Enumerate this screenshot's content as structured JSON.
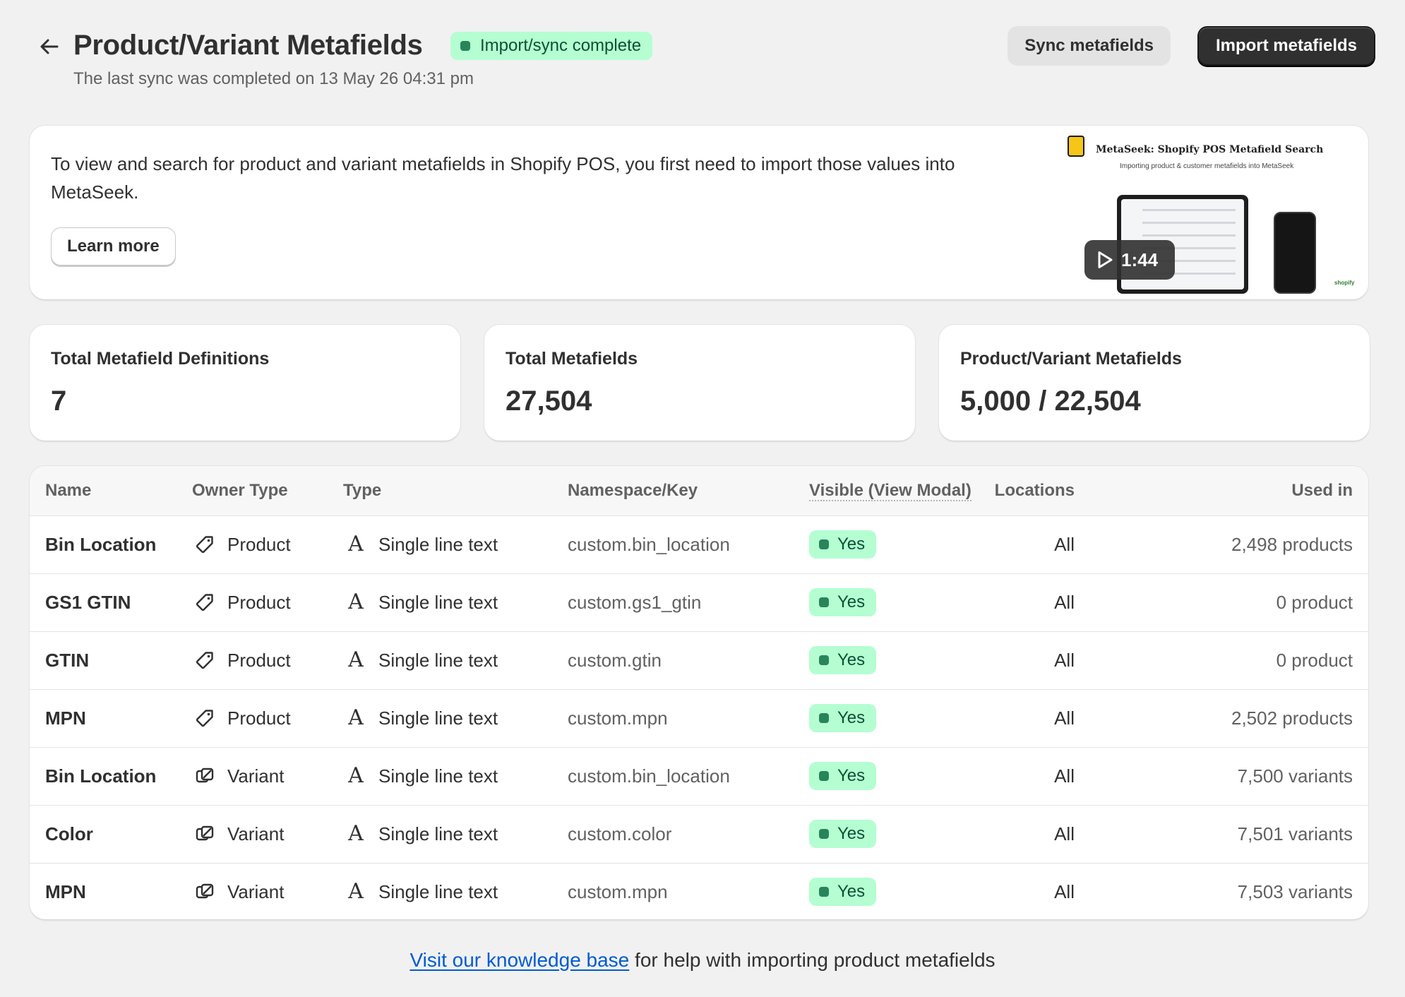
{
  "header": {
    "title": "Product/Variant Metafields",
    "status_badge": "Import/sync complete",
    "subtitle": "The last sync was completed on 13 May 26 04:31 pm",
    "sync_button": "Sync metafields",
    "import_button": "Import metafields",
    "back_icon": "arrow-left-icon"
  },
  "banner": {
    "text": "To view and search for product and variant metafields in Shopify POS, you first need to import those values into MetaSeek.",
    "learn_more": "Learn more",
    "video": {
      "title": "MetaSeek: Shopify POS Metafield Search",
      "subtitle": "Importing product & customer metafields into MetaSeek",
      "duration": "1:44",
      "brand": "shopify"
    }
  },
  "stats": [
    {
      "label": "Total Metafield Definitions",
      "value": "7"
    },
    {
      "label": "Total Metafields",
      "value": "27,504"
    },
    {
      "label": "Product/Variant Metafields",
      "value": "5,000 / 22,504"
    }
  ],
  "table": {
    "columns": [
      "Name",
      "Owner Type",
      "Type",
      "Namespace/Key",
      "Visible (View Modal)",
      "Locations",
      "Used in"
    ],
    "rows": [
      {
        "name": "Bin Location",
        "owner": "Product",
        "owner_icon": "tag-icon",
        "type": "Single line text",
        "type_icon": "text-icon",
        "key": "custom.bin_location",
        "visible": "Yes",
        "locations": "All",
        "used_in": "2,498 products"
      },
      {
        "name": "GS1 GTIN",
        "owner": "Product",
        "owner_icon": "tag-icon",
        "type": "Single line text",
        "type_icon": "text-icon",
        "key": "custom.gs1_gtin",
        "visible": "Yes",
        "locations": "All",
        "used_in": "0 product"
      },
      {
        "name": "GTIN",
        "owner": "Product",
        "owner_icon": "tag-icon",
        "type": "Single line text",
        "type_icon": "text-icon",
        "key": "custom.gtin",
        "visible": "Yes",
        "locations": "All",
        "used_in": "0 product"
      },
      {
        "name": "MPN",
        "owner": "Product",
        "owner_icon": "tag-icon",
        "type": "Single line text",
        "type_icon": "text-icon",
        "key": "custom.mpn",
        "visible": "Yes",
        "locations": "All",
        "used_in": "2,502 products"
      },
      {
        "name": "Bin Location",
        "owner": "Variant",
        "owner_icon": "variant-icon",
        "type": "Single line text",
        "type_icon": "text-icon",
        "key": "custom.bin_location",
        "visible": "Yes",
        "locations": "All",
        "used_in": "7,500 variants"
      },
      {
        "name": "Color",
        "owner": "Variant",
        "owner_icon": "variant-icon",
        "type": "Single line text",
        "type_icon": "text-icon",
        "key": "custom.color",
        "visible": "Yes",
        "locations": "All",
        "used_in": "7,501 variants"
      },
      {
        "name": "MPN",
        "owner": "Variant",
        "owner_icon": "variant-icon",
        "type": "Single line text",
        "type_icon": "text-icon",
        "key": "custom.mpn",
        "visible": "Yes",
        "locations": "All",
        "used_in": "7,503 variants"
      }
    ]
  },
  "footer": {
    "link_text": "Visit our knowledge base",
    "rest_text": " for help with importing product metafields"
  },
  "colors": {
    "success_bg": "#b4fed2",
    "success_text": "#0c5132",
    "success_dot": "#29845a",
    "primary_button": "#303030",
    "link": "#005bd3",
    "page_bg": "#f1f1f1"
  }
}
